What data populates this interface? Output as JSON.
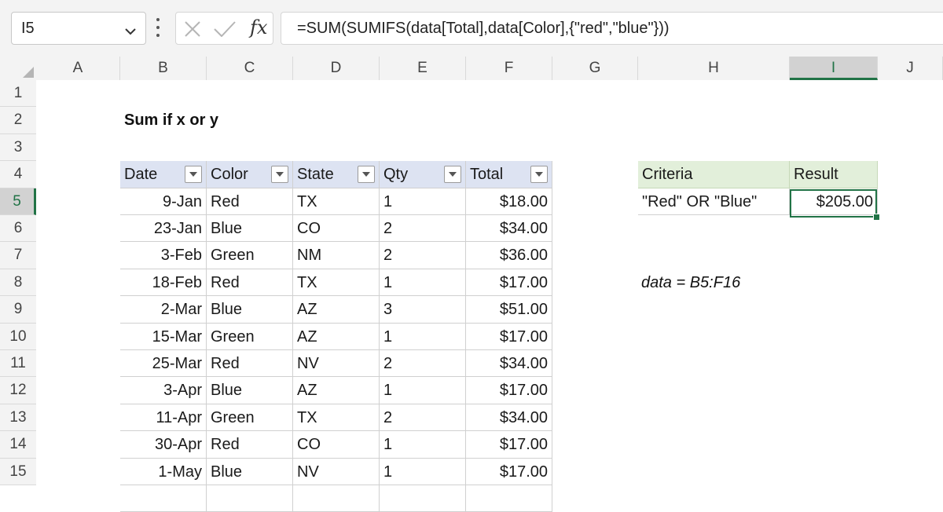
{
  "formula_bar": {
    "name_box": "I5",
    "formula": "=SUM(SUMIFS(data[Total],data[Color],{\"red\",\"blue\"}))",
    "fx_label": "fx"
  },
  "columns": [
    "A",
    "B",
    "C",
    "D",
    "E",
    "F",
    "G",
    "H",
    "I",
    "J"
  ],
  "selected_column": "I",
  "rows": [
    "1",
    "2",
    "3",
    "4",
    "5",
    "6",
    "7",
    "8",
    "9",
    "10",
    "11",
    "12",
    "13",
    "14",
    "15"
  ],
  "selected_row": "5",
  "sheet": {
    "title": "Sum if x or y",
    "note": "data = B5:F16"
  },
  "table": {
    "headers": [
      "Date",
      "Color",
      "State",
      "Qty",
      "Total"
    ],
    "rows": [
      [
        "9-Jan",
        "Red",
        "TX",
        "1",
        "$18.00"
      ],
      [
        "23-Jan",
        "Blue",
        "CO",
        "2",
        "$34.00"
      ],
      [
        "3-Feb",
        "Green",
        "NM",
        "2",
        "$36.00"
      ],
      [
        "18-Feb",
        "Red",
        "TX",
        "1",
        "$17.00"
      ],
      [
        "2-Mar",
        "Blue",
        "AZ",
        "3",
        "$51.00"
      ],
      [
        "15-Mar",
        "Green",
        "AZ",
        "1",
        "$17.00"
      ],
      [
        "25-Mar",
        "Red",
        "NV",
        "2",
        "$34.00"
      ],
      [
        "3-Apr",
        "Blue",
        "AZ",
        "1",
        "$17.00"
      ],
      [
        "11-Apr",
        "Green",
        "TX",
        "2",
        "$34.00"
      ],
      [
        "30-Apr",
        "Red",
        "CO",
        "1",
        "$17.00"
      ],
      [
        "1-May",
        "Blue",
        "NV",
        "1",
        "$17.00"
      ]
    ]
  },
  "criteria_table": {
    "headers": [
      "Criteria",
      "Result"
    ],
    "criteria": "\"Red\" OR \"Blue\"",
    "result": "$205.00"
  },
  "colors": {
    "accent": "#217346",
    "table_header": "#dde3f2",
    "criteria_header": "#e2efda"
  }
}
